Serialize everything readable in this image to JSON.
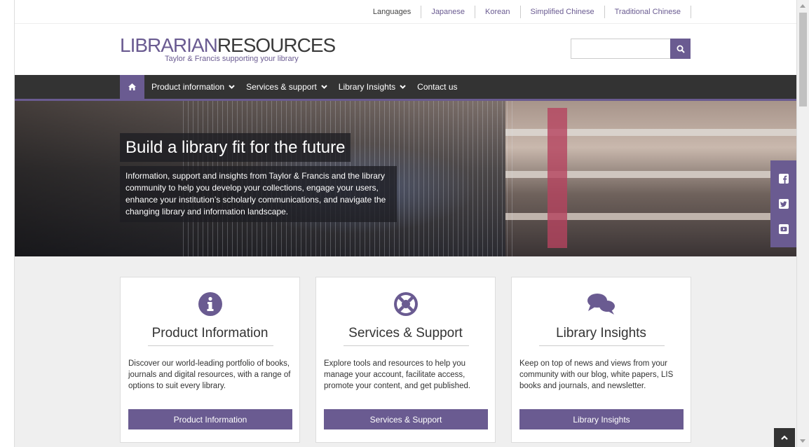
{
  "languages": {
    "label": "Languages",
    "items": [
      "Japanese",
      "Korean",
      "Simplified Chinese",
      "Traditional Chinese"
    ]
  },
  "header": {
    "logo_part1": "LIBRARIAN",
    "logo_part2": "RESOURCES",
    "tagline": "Taylor & Francis supporting your library",
    "search_placeholder": ""
  },
  "nav": {
    "items": [
      {
        "label": "Product information",
        "dropdown": true
      },
      {
        "label": "Services & support",
        "dropdown": true
      },
      {
        "label": "Library Insights",
        "dropdown": true
      },
      {
        "label": "Contact us",
        "dropdown": false
      }
    ]
  },
  "hero": {
    "title": "Build a library fit for the future",
    "text": "Information, support and insights from Taylor & Francis and the library community to help you develop your collections, engage your users, enhance your institution’s scholarly communications, and navigate the changing library and information landscape."
  },
  "cards": [
    {
      "title": "Product Information",
      "text": "Discover our world-leading portfolio of books, journals and digital resources, with a range of options to suit every library.",
      "button": "Product Information",
      "icon": "info-icon"
    },
    {
      "title": "Services & Support",
      "text": "Explore tools and resources to help you manage your account, facilitate access, promote your content, and get published.",
      "button": "Services & Support",
      "icon": "lifebuoy-icon"
    },
    {
      "title": "Library Insights",
      "text": "Keep on top of news and views from your community with our blog, white papers, LIS books and journals, and newsletter.",
      "button": "Library Insights",
      "icon": "speech-bubbles-icon"
    }
  ],
  "colors": {
    "accent": "#6a5b91",
    "nav_bg": "#333333",
    "page_bg": "#efefef"
  }
}
